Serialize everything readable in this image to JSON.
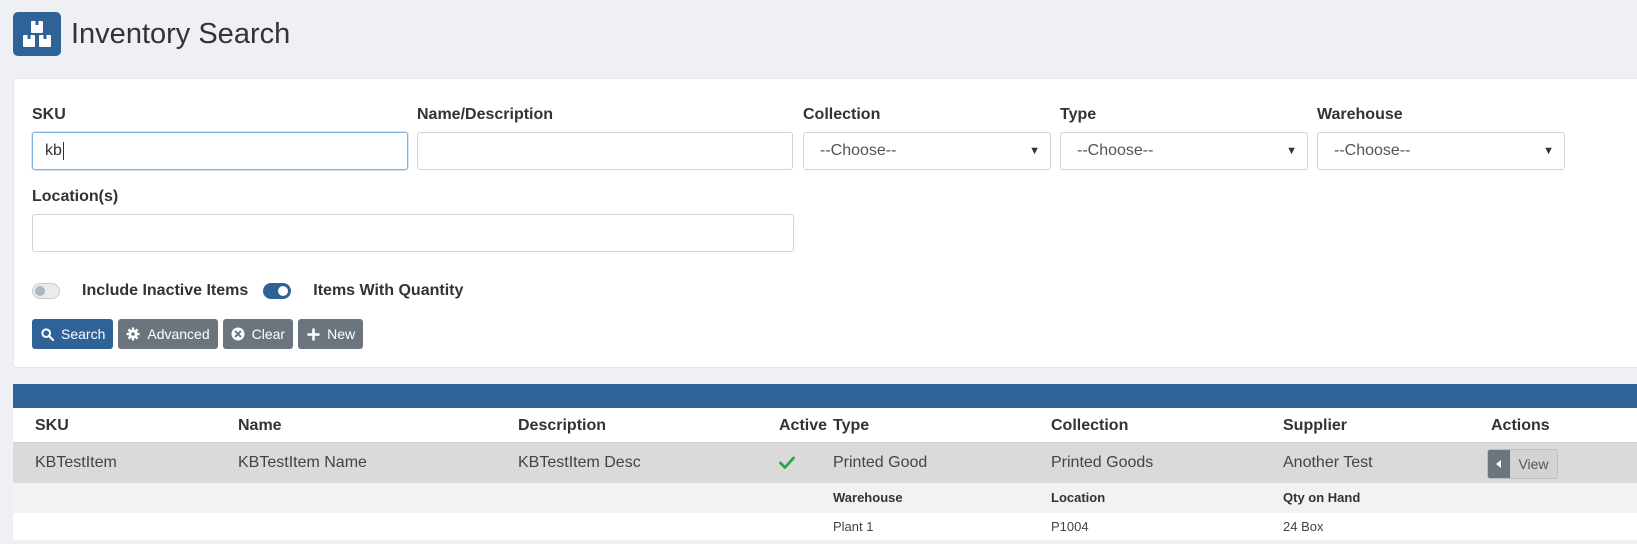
{
  "header": {
    "title": "Inventory Search",
    "icon": "boxes-icon"
  },
  "filters": {
    "sku": {
      "label": "SKU",
      "value": "kb",
      "placeholder": ""
    },
    "name": {
      "label": "Name/Description",
      "value": "",
      "placeholder": ""
    },
    "collection": {
      "label": "Collection",
      "selected": "--Choose--"
    },
    "type": {
      "label": "Type",
      "selected": "--Choose--"
    },
    "warehouse": {
      "label": "Warehouse",
      "selected": "--Choose--"
    },
    "locations": {
      "label": "Location(s)",
      "value": "",
      "placeholder": ""
    },
    "include_inactive": {
      "label": "Include Inactive Items",
      "on": false
    },
    "items_with_quantity": {
      "label": "Items With Quantity",
      "on": true
    }
  },
  "buttons": {
    "search": "Search",
    "advanced": "Advanced",
    "clear": "Clear",
    "new": "New"
  },
  "colors": {
    "primary": "#2f6296",
    "secondary": "#6c757d",
    "active_check": "#28a745"
  },
  "table": {
    "columns": [
      "SKU",
      "Name",
      "Description",
      "Active",
      "Type",
      "Collection",
      "Supplier",
      "Actions"
    ],
    "rows": [
      {
        "sku": "KBTestItem",
        "name": "KBTestItem Name",
        "description": "KBTestItem Desc",
        "active": true,
        "type": "Printed Good",
        "collection": "Printed Goods",
        "supplier": "Another Test",
        "action": "View",
        "details": {
          "columns": [
            "Warehouse",
            "Location",
            "Qty on Hand"
          ],
          "rows": [
            {
              "warehouse": "Plant 1",
              "location": "P1004",
              "qty": "24 Box"
            }
          ]
        }
      }
    ]
  }
}
